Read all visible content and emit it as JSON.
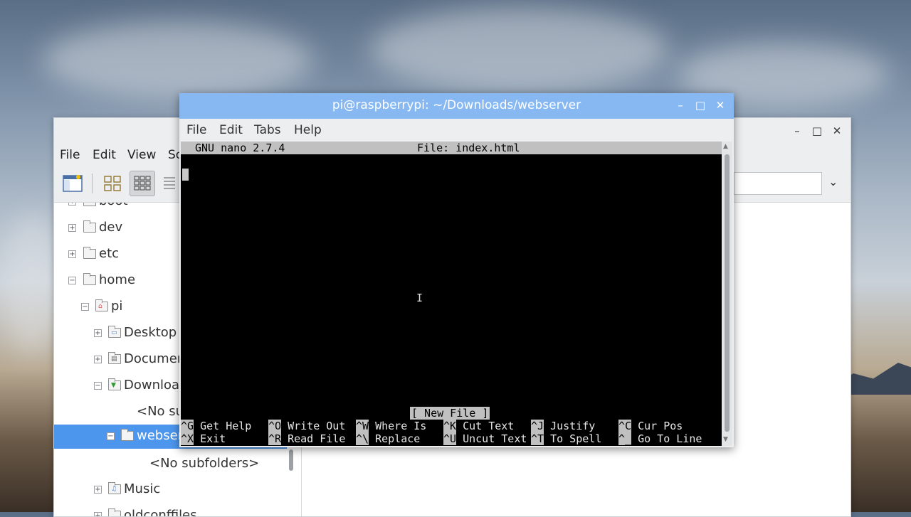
{
  "file_manager": {
    "window_controls": {
      "minimize": "–",
      "maximize": "□",
      "close": "✕"
    },
    "menu": [
      "File",
      "Edit",
      "View",
      "So"
    ],
    "toolbar_icons": [
      "new-window-icon",
      "icon-view-icon",
      "thumbnail-view-icon",
      "list-view-icon"
    ],
    "path_dropdown_icon": "chevron-down-icon",
    "tree": [
      {
        "label": "boot",
        "expander": "+",
        "indent": 0,
        "icon": "folder"
      },
      {
        "label": "dev",
        "expander": "+",
        "indent": 0,
        "icon": "folder"
      },
      {
        "label": "etc",
        "expander": "+",
        "indent": 0,
        "icon": "folder"
      },
      {
        "label": "home",
        "expander": "−",
        "indent": 0,
        "icon": "folder"
      },
      {
        "label": "pi",
        "expander": "−",
        "indent": 1,
        "icon": "home-folder"
      },
      {
        "label": "Desktop",
        "expander": "+",
        "indent": 2,
        "icon": "desktop-folder"
      },
      {
        "label": "Documents",
        "expander": "+",
        "indent": 2,
        "icon": "documents-folder"
      },
      {
        "label": "Downloads",
        "expander": "−",
        "indent": 2,
        "icon": "downloads-folder"
      },
      {
        "label": "<No subfolders>",
        "expander": "",
        "indent": 3,
        "icon": ""
      },
      {
        "label": "webserver",
        "expander": "−",
        "indent": 3,
        "icon": "folder",
        "selected": true
      },
      {
        "label": "<No subfolders>",
        "expander": "",
        "indent": 4,
        "icon": ""
      },
      {
        "label": "Music",
        "expander": "+",
        "indent": 2,
        "icon": "music-folder"
      },
      {
        "label": "oldconffiles",
        "expander": "+",
        "indent": 2,
        "icon": "folder"
      }
    ]
  },
  "terminal": {
    "title": "pi@raspberrypi: ~/Downloads/webserver",
    "window_controls": {
      "minimize": "–",
      "maximize": "□",
      "close": "✕"
    },
    "menu": [
      "File",
      "Edit",
      "Tabs",
      "Help"
    ],
    "nano": {
      "version": "GNU nano 2.7.4",
      "file": "File: index.html",
      "status": "[ New File ]",
      "shortcuts_row1": [
        {
          "key": "^G",
          "label": "Get Help"
        },
        {
          "key": "^O",
          "label": "Write Out"
        },
        {
          "key": "^W",
          "label": "Where Is"
        },
        {
          "key": "^K",
          "label": "Cut Text"
        },
        {
          "key": "^J",
          "label": "Justify"
        },
        {
          "key": "^C",
          "label": "Cur Pos"
        }
      ],
      "shortcuts_row2": [
        {
          "key": "^X",
          "label": "Exit"
        },
        {
          "key": "^R",
          "label": "Read File"
        },
        {
          "key": "^\\",
          "label": "Replace"
        },
        {
          "key": "^U",
          "label": "Uncut Text"
        },
        {
          "key": "^T",
          "label": "To Spell"
        },
        {
          "key": "^_",
          "label": "Go To Line"
        }
      ]
    }
  },
  "colors": {
    "terminal_titlebar": "#87b8f2",
    "selection": "#4d96ee",
    "nano_bar": "#c0c0c0"
  }
}
